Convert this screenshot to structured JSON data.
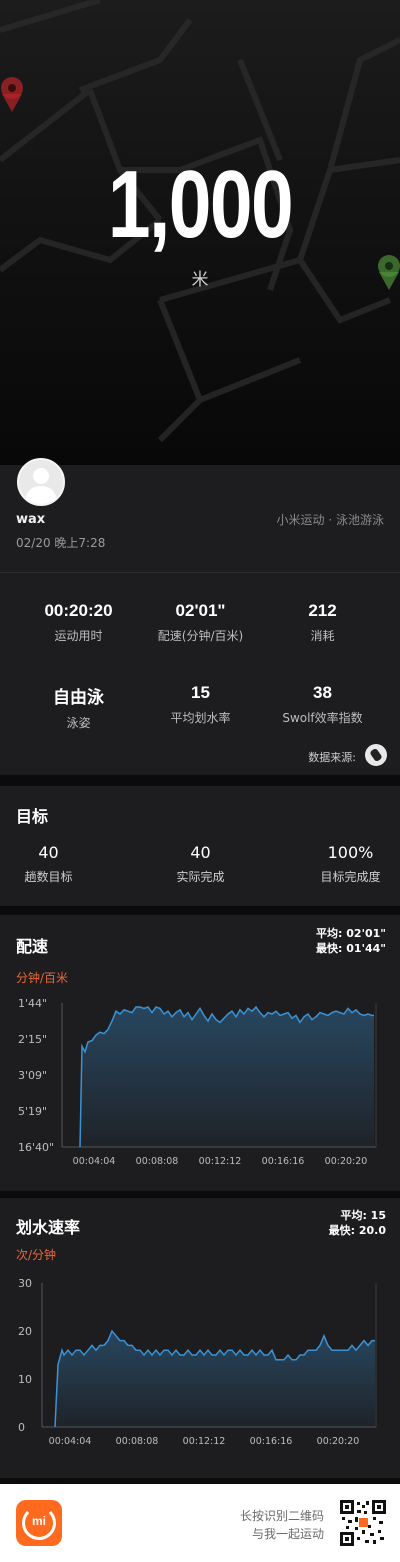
{
  "hero": {
    "distance": "1,000",
    "unit": "米"
  },
  "profile": {
    "username": "wax",
    "source": "小米运动 · 泳池游泳",
    "datetime": "02/20 晚上7:28"
  },
  "stats": [
    {
      "value": "00:20:20",
      "label": "运动用时"
    },
    {
      "value": "02'01\"",
      "label": "配速(分钟/百米)"
    },
    {
      "value": "212",
      "label": "消耗"
    },
    {
      "value": "自由泳",
      "label": "泳姿"
    },
    {
      "value": "15",
      "label": "平均划水率"
    },
    {
      "value": "38",
      "label": "Swolf效率指数"
    }
  ],
  "data_source_label": "数据来源:",
  "goals": {
    "title": "目标",
    "items": [
      {
        "value": "40",
        "label": "趟数目标"
      },
      {
        "value": "40",
        "label": "实际完成"
      },
      {
        "value": "100%",
        "label": "目标完成度"
      }
    ]
  },
  "pace": {
    "title": "配速",
    "avg": "平均: 02'01\"",
    "max": "最快: 01'44\"",
    "unit": "分钟/百米"
  },
  "stroke": {
    "title": "划水速率",
    "avg": "平均: 15",
    "max": "最快: 20.0",
    "unit": "次/分钟"
  },
  "footer": {
    "line1": "长按识别二维码",
    "line2": "与我一起运动",
    "logo_text": "mi"
  },
  "colors": {
    "accent": "#e8683a",
    "line": "#3b93d6",
    "background": "#1d1d1f"
  },
  "chart_data": [
    {
      "type": "area",
      "ylabel": "分钟/百米",
      "yticks": [
        "1'44\"",
        "2'15\"",
        "3'09\"",
        "5'19\"",
        "16'40\""
      ],
      "xticks": [
        "00:04:04",
        "00:08:08",
        "00:12:12",
        "00:16:16",
        "00:20:20"
      ],
      "x": [
        80,
        82,
        85,
        88,
        92,
        96,
        100,
        104,
        108,
        112,
        116,
        120,
        124,
        128,
        132,
        136,
        140,
        144,
        148,
        152,
        156,
        160,
        164,
        168,
        172,
        176,
        180,
        184,
        188,
        192,
        196,
        200,
        204,
        208,
        212,
        216,
        220,
        224,
        228,
        232,
        236,
        240,
        244,
        248,
        252,
        256,
        260,
        264,
        268,
        272,
        276,
        280,
        284,
        288,
        292,
        296,
        300,
        304,
        308,
        312,
        316,
        320,
        324,
        328,
        332,
        336,
        340,
        344,
        348,
        352,
        356,
        360,
        364,
        368,
        372,
        374
      ],
      "values": [
        0.0,
        0.72,
        0.68,
        0.75,
        0.76,
        0.8,
        0.82,
        0.81,
        0.84,
        0.9,
        0.97,
        0.95,
        0.98,
        0.97,
        0.96,
        1.0,
        1.0,
        0.99,
        1.0,
        0.96,
        1.0,
        0.99,
        0.95,
        0.97,
        0.93,
        0.96,
        0.98,
        0.93,
        0.96,
        0.91,
        0.95,
        0.99,
        0.94,
        0.9,
        0.95,
        0.91,
        0.89,
        0.92,
        0.95,
        0.97,
        0.93,
        0.98,
        0.95,
        0.99,
        0.97,
        1.0,
        0.96,
        0.93,
        0.96,
        0.95,
        0.97,
        0.94,
        0.95,
        0.96,
        0.92,
        0.94,
        0.89,
        0.93,
        0.95,
        0.91,
        0.93,
        0.96,
        0.95,
        0.94,
        0.96,
        0.97,
        0.96,
        0.95,
        0.99,
        0.96,
        0.98,
        0.95,
        0.94,
        0.95,
        0.94,
        0.94
      ]
    },
    {
      "type": "area",
      "ylabel": "次/分钟",
      "yticks": [
        "30",
        "20",
        "10",
        "0"
      ],
      "ylim": [
        0,
        30
      ],
      "xticks": [
        "00:04:04",
        "00:08:08",
        "00:12:12",
        "00:16:16",
        "00:20:20"
      ],
      "x": [
        55,
        58,
        62,
        64,
        68,
        72,
        76,
        80,
        84,
        88,
        92,
        96,
        100,
        104,
        108,
        112,
        116,
        120,
        124,
        128,
        132,
        136,
        140,
        144,
        148,
        152,
        156,
        160,
        164,
        168,
        172,
        176,
        180,
        184,
        188,
        192,
        196,
        200,
        204,
        208,
        212,
        216,
        220,
        224,
        228,
        232,
        236,
        240,
        244,
        248,
        252,
        256,
        260,
        264,
        268,
        272,
        276,
        280,
        284,
        288,
        292,
        296,
        300,
        304,
        308,
        312,
        316,
        320,
        324,
        328,
        332,
        336,
        340,
        344,
        348,
        352,
        356,
        360,
        364,
        368,
        372,
        375
      ],
      "values": [
        0,
        13,
        16,
        15,
        16,
        15,
        16,
        16,
        15,
        16,
        17,
        16,
        17,
        17,
        18,
        20,
        19,
        18,
        18,
        17,
        17,
        16,
        16,
        15,
        16,
        15,
        16,
        15,
        16,
        16,
        15,
        16,
        15,
        15,
        16,
        15,
        15,
        16,
        15,
        16,
        15,
        15,
        16,
        15,
        16,
        16,
        15,
        16,
        15,
        15,
        16,
        15,
        16,
        15,
        15,
        16,
        14,
        14,
        14,
        15,
        14,
        14,
        15,
        15,
        16,
        16,
        16,
        17,
        19,
        17,
        16,
        16,
        16,
        16,
        16,
        17,
        16,
        17,
        18,
        17,
        18,
        18
      ]
    }
  ]
}
